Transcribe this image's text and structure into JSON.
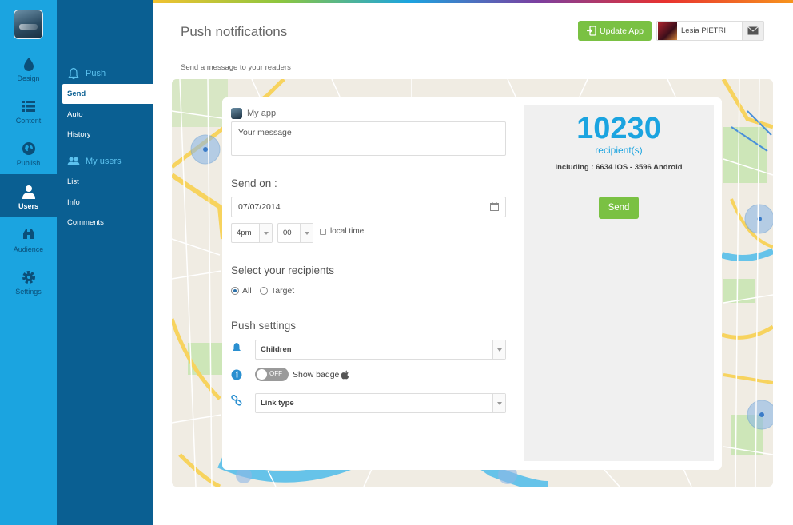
{
  "rail": {
    "items": [
      {
        "label": "Design"
      },
      {
        "label": "Content"
      },
      {
        "label": "Publish"
      },
      {
        "label": "Users"
      },
      {
        "label": "Audience"
      },
      {
        "label": "Settings"
      }
    ]
  },
  "subnav": {
    "push_heading": "Push",
    "push_items": [
      "Send",
      "Auto",
      "History"
    ],
    "users_heading": "My users",
    "users_items": [
      "List",
      "Info",
      "Comments"
    ]
  },
  "header": {
    "title": "Push notifications",
    "subtitle": "Send a message to your readers",
    "update_label": "Update App",
    "user_name": "Lesia PIETRI"
  },
  "form": {
    "app_name": "My app",
    "message_placeholder": "Your message",
    "send_on_label": "Send on :",
    "date_value": "07/07/2014",
    "hour_value": "4pm",
    "minute_value": "00",
    "local_time_label": "local time",
    "recipients_label": "Select your recipients",
    "recipient_all": "All",
    "recipient_target": "Target",
    "push_settings_label": "Push settings",
    "sound_value": "Children",
    "badge_toggle": "OFF",
    "badge_label": "Show badge",
    "link_value": "Link type"
  },
  "summary": {
    "count": "10230",
    "count_label": "recipient(s)",
    "detail": "including : 6634 iOS - 3596 Android",
    "send_label": "Send"
  },
  "colors": {
    "rail": "#1ba4e0",
    "subnav": "#0a5f92",
    "accent_green": "#7ac143",
    "count_blue": "#1ba4e0"
  },
  "icons": {
    "rail": [
      "drop-icon",
      "list-icon",
      "globe-icon",
      "user-icon",
      "binoculars-icon",
      "gear-icon"
    ],
    "push_heading": "bell-icon",
    "users_heading": "users-icon",
    "push_settings": [
      "bell-icon",
      "badge-number-icon",
      "link-icon"
    ]
  }
}
